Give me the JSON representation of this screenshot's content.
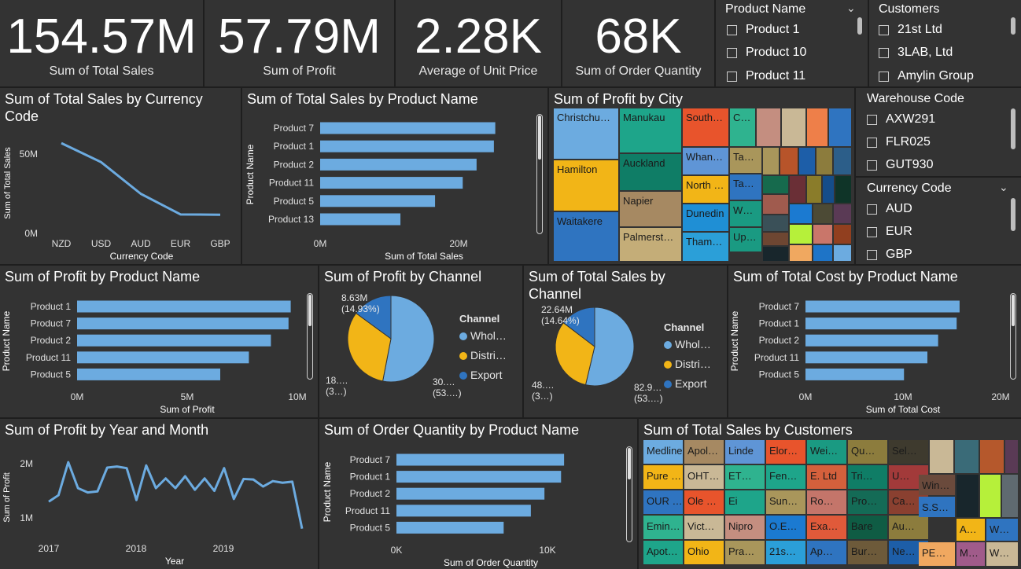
{
  "kpis": [
    {
      "value": "154.57M",
      "label": "Sum of Total Sales"
    },
    {
      "value": "57.79M",
      "label": "Sum of Profit"
    },
    {
      "value": "2.28K",
      "label": "Average of Unit Price"
    },
    {
      "value": "68K",
      "label": "Sum of Order Quantity"
    }
  ],
  "slicers": {
    "product": {
      "title": "Product Name",
      "items": [
        "Product 1",
        "Product 10",
        "Product 11"
      ]
    },
    "customers": {
      "title": "Customers",
      "items": [
        "21st Ltd",
        "3LAB, Ltd",
        "Amylin Group"
      ]
    },
    "warehouse": {
      "title": "Warehouse Code",
      "items": [
        "AXW291",
        "FLR025",
        "GUT930"
      ]
    },
    "currency": {
      "title": "Currency Code",
      "items": [
        "AUD",
        "EUR",
        "GBP"
      ]
    }
  },
  "colors": {
    "bar": "#6cabe0",
    "pie_wholesale": "#6cabe0",
    "pie_distributor": "#f2b517",
    "pie_export": "#2f74c0",
    "panel": "#333333"
  },
  "chart_data": [
    {
      "id": "sales_by_currency",
      "type": "line",
      "title": "Sum of Total Sales by Currency Code",
      "xlabel": "Currency Code",
      "ylabel": "Sum of Total Sales",
      "categories": [
        "NZD",
        "USD",
        "AUD",
        "EUR",
        "GBP"
      ],
      "values": [
        57,
        45,
        25,
        12,
        11.8
      ],
      "ylim": [
        0,
        66
      ],
      "yticks": [
        0,
        50
      ],
      "yticklabels": [
        "0M",
        "50M"
      ]
    },
    {
      "id": "sales_by_product",
      "type": "bar",
      "orientation": "horizontal",
      "title": "Sum of Total Sales by Product Name",
      "xlabel": "Sum of Total Sales",
      "ylabel": "Product Name",
      "categories": [
        "Product 7",
        "Product 1",
        "Product 2",
        "Product 11",
        "Product 5",
        "Product 13"
      ],
      "values": [
        25.3,
        25.1,
        22.6,
        20.6,
        16.6,
        11.6
      ],
      "xlim": [
        0,
        30
      ],
      "xticks": [
        0,
        20
      ],
      "xticklabels": [
        "0M",
        "20M"
      ]
    },
    {
      "id": "profit_by_city",
      "type": "heatmap",
      "title": "Sum of Profit by City",
      "labels": [
        "Christchu…",
        "Manukau",
        "South…",
        "C…",
        "Hamilton",
        "Auckland",
        "Whan…",
        "Ta…",
        "North …",
        "Ta…",
        "Napier",
        "Waitakere",
        "Dunedin",
        "W…",
        "Palmerst…",
        "Up…",
        "Tham…"
      ],
      "colors": [
        "#6cabe0",
        "#1ea58a",
        "#e8542c",
        "#2fb38f",
        "#f2b517",
        "#0f7d66",
        "#5f95d6",
        "#a9965b",
        "#f2b517",
        "#2f74c0",
        "#a68962",
        "#2f74c0",
        "#1f8fd5",
        "#1a9a82",
        "#c4ad78",
        "#1a9a82",
        "#2b9fd8",
        "#c48e80",
        "#c9b896",
        "#ee7f49",
        "#2f74c0",
        "#a9965b",
        "#b7542a",
        "#1d5ea8",
        "#8c7c3d",
        "#2c5e89",
        "#166a4d",
        "#6a2f36",
        "#8a7c2a",
        "#154d8a",
        "#0f3428",
        "#a05b4e",
        "#7a5b3a",
        "#3a5058",
        "#1b7ad1",
        "#4c4a35",
        "#5a3a55",
        "#6d4632",
        "#b6f03a",
        "#c9766a",
        "#913f1f",
        "#18262c",
        "#f0a860",
        "#1e74c7"
      ]
    },
    {
      "id": "profit_by_product",
      "type": "bar",
      "orientation": "horizontal",
      "title": "Sum of Profit by Product Name",
      "xlabel": "Sum of Profit",
      "ylabel": "Product Name",
      "categories": [
        "Product 1",
        "Product 7",
        "Product 2",
        "Product 11",
        "Product 5"
      ],
      "values": [
        9.7,
        9.6,
        8.8,
        7.8,
        6.5
      ],
      "xlim": [
        0,
        10
      ],
      "xticks": [
        0,
        5,
        10
      ],
      "xticklabels": [
        "0M",
        "5M",
        "10M"
      ]
    },
    {
      "id": "profit_by_channel",
      "type": "pie",
      "title": "Sum of Profit by Channel",
      "legend_title": "Channel",
      "labels": [
        "Whol…",
        "Distri…",
        "Export"
      ],
      "full_labels": [
        "Wholesale",
        "Distributor",
        "Export"
      ],
      "values": [
        53,
        32,
        14.93
      ],
      "data_labels": [
        [
          "30.…",
          "(53.…)"
        ],
        [
          "18.…",
          "(3…)"
        ],
        [
          "8.63M",
          "(14.93%)"
        ]
      ]
    },
    {
      "id": "sales_by_channel",
      "type": "pie",
      "title": "Sum of Total Sales by Channel",
      "legend_title": "Channel",
      "labels": [
        "Whol…",
        "Distri…",
        "Export"
      ],
      "full_labels": [
        "Wholesale",
        "Distributor",
        "Export"
      ],
      "values": [
        53.7,
        31.66,
        14.64
      ],
      "data_labels": [
        [
          "82.9…",
          "(53.…)"
        ],
        [
          "48.…",
          "(3…)"
        ],
        [
          "22.64M",
          "(14.64%)"
        ]
      ]
    },
    {
      "id": "cost_by_product",
      "type": "bar",
      "orientation": "horizontal",
      "title": "Sum of Total Cost by Product Name",
      "xlabel": "Sum of Total Cost",
      "ylabel": "Product Name",
      "categories": [
        "Product 7",
        "Product 1",
        "Product 2",
        "Product 11",
        "Product 5"
      ],
      "values": [
        15.8,
        15.5,
        13.6,
        12.5,
        10.1
      ],
      "xlim": [
        0,
        20
      ],
      "xticks": [
        0,
        10,
        20
      ],
      "xticklabels": [
        "0M",
        "10M",
        "20M"
      ]
    },
    {
      "id": "profit_by_month",
      "type": "line",
      "title": "Sum of Profit by Year and Month",
      "xlabel": "Year",
      "ylabel": "Sum of Profit",
      "x_ticklabels": [
        "2017",
        "2018",
        "2019"
      ],
      "values": [
        1.3,
        1.42,
        2.03,
        1.55,
        1.47,
        1.49,
        1.93,
        1.95,
        1.92,
        1.33,
        1.97,
        1.55,
        1.73,
        1.55,
        1.77,
        1.52,
        1.73,
        1.5,
        1.92,
        1.35,
        1.72,
        1.71,
        1.58,
        1.68,
        1.65,
        1.67,
        0.8
      ],
      "ylim": [
        0.65,
        2.25
      ],
      "yticks": [
        1,
        2
      ],
      "yticklabels": [
        "1M",
        "2M"
      ]
    },
    {
      "id": "qty_by_product",
      "type": "bar",
      "orientation": "horizontal",
      "title": "Sum of Order Quantity by Product Name",
      "xlabel": "Sum of Order Quantity",
      "ylabel": "Product Name",
      "categories": [
        "Product 7",
        "Product 1",
        "Product 2",
        "Product 11",
        "Product 5"
      ],
      "values": [
        11.1,
        10.9,
        9.8,
        8.9,
        7.1
      ],
      "xlim": [
        0,
        12.5
      ],
      "xticks": [
        0,
        10
      ],
      "xticklabels": [
        "0K",
        "10K"
      ]
    },
    {
      "id": "sales_by_customers",
      "type": "heatmap",
      "title": "Sum of Total Sales by Customers",
      "labels": [
        "Medline",
        "Apol…",
        "Linde",
        "Elor…",
        "Wei…",
        "Qu…",
        "Sel…",
        "Pure …",
        "OHT…",
        "ET…",
        "Fen…",
        "E. Ltd",
        "Tri…",
        "U…",
        "OUR …",
        "Ole …",
        "Ei",
        "Sun…",
        "Ro…",
        "Pro…",
        "Ca…",
        "Emin…",
        "Vict…",
        "Nipro",
        "O.E…",
        "Exa…",
        "Bare",
        "Au…",
        "Apot…",
        "Ohio",
        "Pra…",
        "21s…",
        "Ap…",
        "Bur…",
        "Ne…",
        "Win…",
        "S.S…",
        "A…",
        "W…",
        "PE…",
        "M…",
        "W…"
      ],
      "colors": [
        "#6cabe0",
        "#a68962",
        "#5f95d6",
        "#e8542c",
        "#1a9a82",
        "#8c7c3d",
        "#3e3a2e",
        "#f2b517",
        "#c9b896",
        "#2fb38f",
        "#1ea58a",
        "#d4603c",
        "#0f7d66",
        "#a23a3a",
        "#2f74c0",
        "#e8542c",
        "#1ea58a",
        "#a9965b",
        "#c4756a",
        "#146b56",
        "#8a4030",
        "#2fb38f",
        "#c9b896",
        "#c48e80",
        "#1b7ad1",
        "#e05a3a",
        "#0f5c44",
        "#8c7c3d",
        "#1ea58a",
        "#f2b517",
        "#a9965b",
        "#2b9fd8",
        "#2f74c0",
        "#6d5a3a",
        "#1d5ea8",
        "#6a4a3c",
        "#2f74c0",
        "#f2b517",
        "#2f74c0",
        "#f0a860",
        "#a05b8a",
        "#c9b896",
        "#3a6b78",
        "#b5582c",
        "#5a3a55",
        "#18262c",
        "#b6f03a",
        "#5f6a70",
        "#8aa0e0"
      ]
    }
  ]
}
